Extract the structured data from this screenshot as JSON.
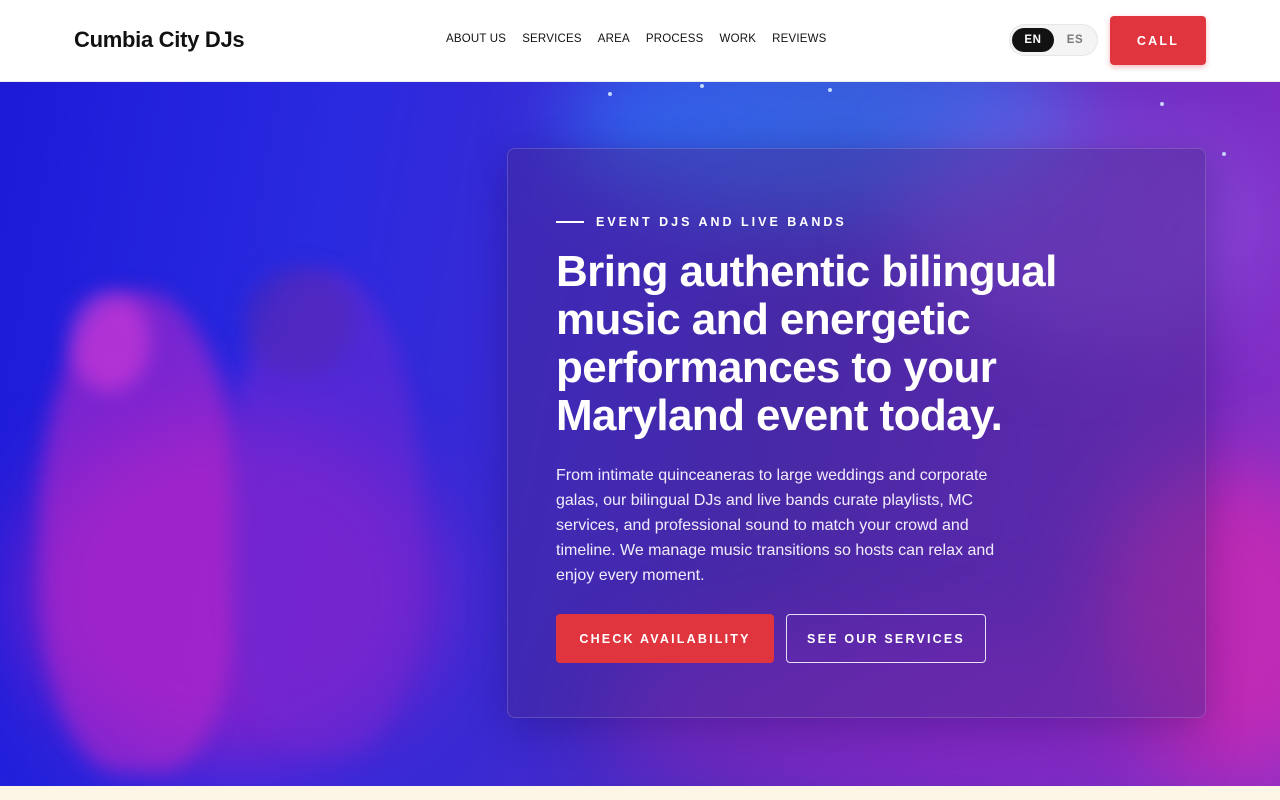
{
  "header": {
    "logo": "Cumbia City DJs",
    "nav": [
      "ABOUT US",
      "SERVICES",
      "AREA",
      "PROCESS",
      "WORK",
      "REVIEWS"
    ],
    "lang_options": [
      "EN",
      "ES"
    ],
    "lang_selected": "EN",
    "call_label": "CALL"
  },
  "hero": {
    "eyebrow": "EVENT DJS AND LIVE BANDS",
    "headline": "Bring authentic bilingual music and energetic performances to your Maryland event today.",
    "description": "From intimate quinceaneras to large weddings and corporate galas, our bilingual DJs and live bands curate playlists, MC services, and professional sound to match your crowd and timeline. We manage music transitions so hosts can relax and enjoy every moment.",
    "primary_cta": "CHECK AVAILABILITY",
    "secondary_cta": "SEE OUR SERVICES",
    "background_image": "party-crowd-photo"
  },
  "colors": {
    "accent": "#e0343f",
    "hero_blue": "#2a2ae0",
    "hero_purple": "#8a30c8"
  }
}
